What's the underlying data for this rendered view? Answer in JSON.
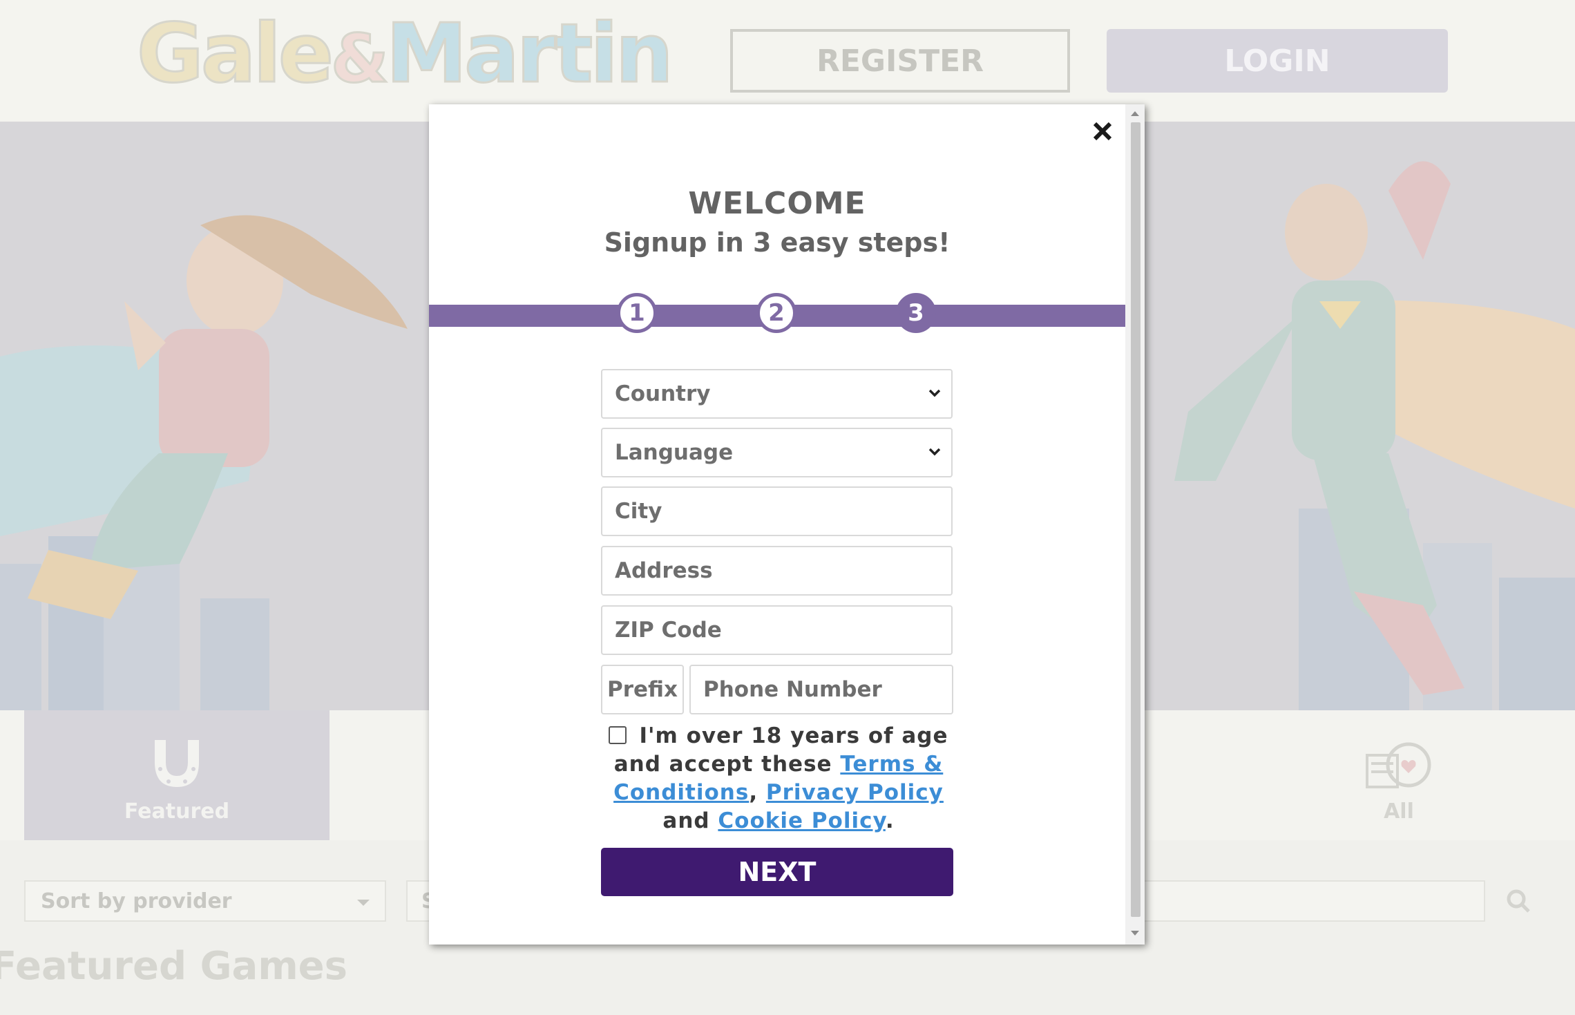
{
  "header": {
    "logo_text": "Gale&Martin",
    "register_label": "REGISTER",
    "login_label": "LOGIN"
  },
  "categories": {
    "featured_label": "Featured",
    "all_label": "All"
  },
  "filters": {
    "sort_provider_label": "Sort by provider",
    "second_filter_label": "S"
  },
  "section": {
    "title": "Featured Games"
  },
  "modal": {
    "close_symbol": "✕",
    "title": "WELCOME",
    "subtitle": "Signup in 3 easy steps!",
    "steps": [
      "1",
      "2",
      "3"
    ],
    "current_step": 3,
    "fields": {
      "country_placeholder": "Country",
      "language_placeholder": "Language",
      "city_placeholder": "City",
      "address_placeholder": "Address",
      "zip_placeholder": "ZIP Code",
      "prefix_placeholder": "Prefix",
      "phone_placeholder": "Phone Number"
    },
    "terms": {
      "text_1": "I'm over 18 years of age and accept these",
      "terms_link": "Terms & Conditions",
      "separator": ",",
      "privacy_link": "Privacy Policy",
      "and_text": "and",
      "cookie_link": "Cookie Policy",
      "end": "."
    },
    "next_label": "NEXT"
  },
  "colors": {
    "accent": "#7f6aa4",
    "next_button": "#3f1a70",
    "link": "#3c8dd6"
  }
}
